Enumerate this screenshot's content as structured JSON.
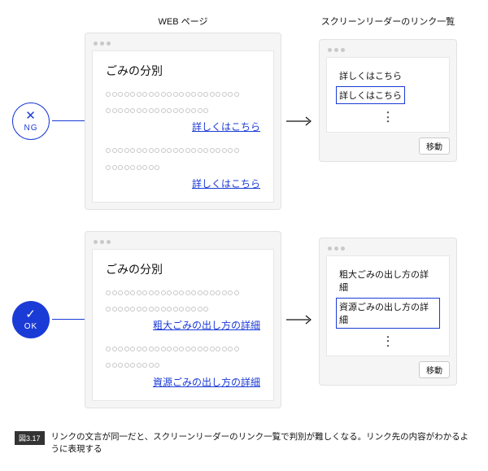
{
  "headers": {
    "page": "WEB ページ",
    "reader": "スクリーンリーダーのリンク一覧"
  },
  "ng": {
    "badge_mark": "✕",
    "badge_label": "NG",
    "page_title": "ごみの分別",
    "link1": "詳しくはこちら",
    "link2": "詳しくはこちら",
    "reader_item1": "詳しくはこちら",
    "reader_item2": "詳しくはこちら",
    "reader_button": "移動"
  },
  "ok": {
    "badge_mark": "✓",
    "badge_label": "OK",
    "page_title": "ごみの分別",
    "link1": "粗大ごみの出し方の詳細",
    "link2": "資源ごみの出し方の詳細",
    "reader_item1": "粗大ごみの出し方の詳細",
    "reader_item2": "資源ごみの出し方の詳細",
    "reader_button": "移動"
  },
  "caption": {
    "tag": "図3.17",
    "text": "リンクの文言が同一だと、スクリーンリーダーのリンク一覧で判別が難しくなる。リンク先の内容がわかるように表現する"
  }
}
